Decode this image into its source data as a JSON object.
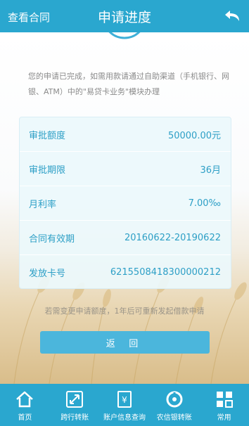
{
  "header": {
    "left_link": "查看合同",
    "title": "申请进度"
  },
  "notice": "您的申请已完成，如需用款请通过自助渠道（手机银行、网银、ATM）中的\"易贷卡业务\"模块办理",
  "details": [
    {
      "label": "审批额度",
      "value": "50000.00元"
    },
    {
      "label": "审批期限",
      "value": "36月"
    },
    {
      "label": "月利率",
      "value": "7.00‰"
    },
    {
      "label": "合同有效期",
      "value": "20160622-20190622"
    },
    {
      "label": "发放卡号",
      "value": "6215508418300000212"
    }
  ],
  "hint": "若需变更申请额度，1年后可重新发起借款申请",
  "back_button": "返 回",
  "tabs": [
    {
      "label": "首页",
      "icon": "home-icon"
    },
    {
      "label": "跨行转账",
      "icon": "transfer-icon"
    },
    {
      "label": "账户信息查询",
      "icon": "account-query-icon"
    },
    {
      "label": "农信银转账",
      "icon": "rural-credit-transfer-icon"
    },
    {
      "label": "常用",
      "icon": "grid-icon"
    }
  ],
  "colors": {
    "primary": "#2aa7cf",
    "button": "#4bb6dc",
    "accent_text": "#2d9fc6"
  }
}
